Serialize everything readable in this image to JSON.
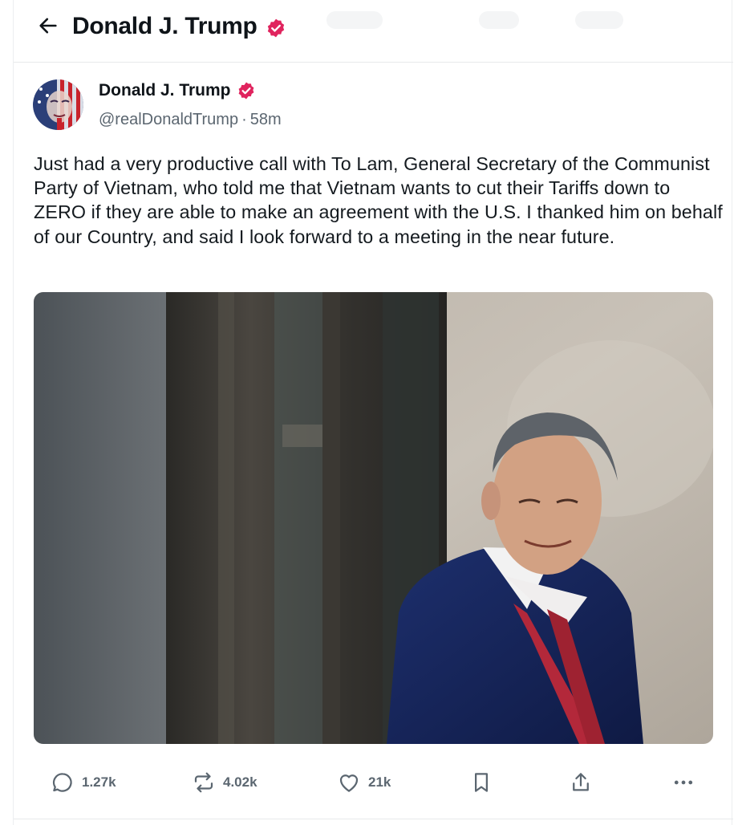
{
  "header": {
    "title": "Donald J. Trump"
  },
  "post": {
    "author_name": "Donald J. Trump",
    "handle": "@realDonaldTrump",
    "separator": "·",
    "time_ago": "58m",
    "text": "Just had a very productive call with To Lam, General Secretary of the Communist Party of Vietnam, who told me that Vietnam wants to cut their Tariffs down to ZERO if they are able to make an agreement with the U.S. I thanked him on behalf of our Country, and said I look forward to a meeting in the near future.",
    "verified_color": "#e0245e"
  },
  "actions": {
    "replies": "1.27k",
    "reposts": "4.02k",
    "likes": "21k"
  },
  "icons": [
    "back-arrow-icon",
    "verified-badge-icon",
    "reply-icon",
    "repost-icon",
    "like-icon",
    "bookmark-icon",
    "share-icon",
    "more-icon"
  ]
}
